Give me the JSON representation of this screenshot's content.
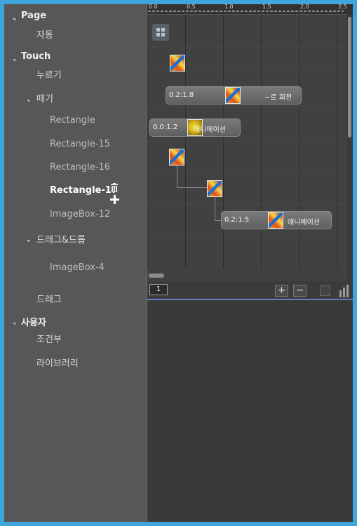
{
  "tree": {
    "page_label": "Page",
    "auto_label": "자동",
    "touch_label": "Touch",
    "press_label": "누르기",
    "release_label": "떼기",
    "rectangle": "Rectangle",
    "rectangle15": "Rectangle-15",
    "rectangle16": "Rectangle-16",
    "rectangle17": "Rectangle-17",
    "imagebox12": "ImageBox-12",
    "dragdrop_label": "드래그&드롭",
    "imagebox4": "ImageBox-4",
    "drag_label": "드래그",
    "user_label": "사용자",
    "conditional_label": "조건부",
    "library_label": "라이브러리"
  },
  "timeline": {
    "ruler_labels": [
      "0.0",
      "0.5",
      "1.0",
      "1.5",
      "2.0",
      "2.5"
    ],
    "clips": [
      {
        "time": "0.2:1.8",
        "name": "~로 회전"
      },
      {
        "time": "0.0:1.2",
        "name": "애니메이션"
      },
      {
        "time": "0.2:1.5",
        "name": "애니메이션"
      }
    ]
  },
  "toolbar": {
    "page_number": "1",
    "add_symbol": "+",
    "remove_symbol": "−"
  },
  "icons": {
    "delete": "trash-icon",
    "add": "plus-icon",
    "grid": "grid-icon",
    "thumbnail": "image-thumbnail-icon"
  },
  "colors": {
    "frame": "#3ea6db",
    "accent_divider": "#6b79c9"
  }
}
